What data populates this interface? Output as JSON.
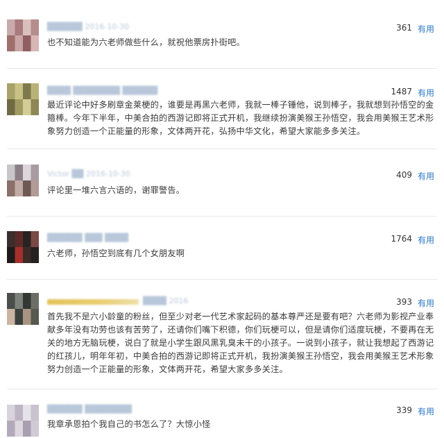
{
  "comments": [
    {
      "likes": "361",
      "useful_label": "有用",
      "text": "也不知道能为六老师做些什么，就祝他票房扑街吧。"
    },
    {
      "likes": "1487",
      "useful_label": "有用",
      "text": "最近评论中好多刷章金莱梗的，谁要是再黑六老师，我就一棒子锤他，说到棒子，我就想到孙悟空的金箍棒。今年下半年，中美合拍的西游记即将正式开机，我继续扮演美猴王孙悟空，我会用美猴王艺术形象努力创造一个正能量的形象，文体两开花，弘扬中华文化，希望大家能多多关注。"
    },
    {
      "likes": "409",
      "useful_label": "有用",
      "text": "评论里一堆六言六语的，谢罪警告。"
    },
    {
      "likes": "1764",
      "useful_label": "有用",
      "text": "六老师，孙悟空到底有几个女朋友啊"
    },
    {
      "likes": "393",
      "useful_label": "有用",
      "text": "首先我不是六小龄童的粉丝，但至少对老一代艺术家起码的基本尊严还是要有吧？六老师为影视产业奉献多年没有功劳也该有苦劳了，还请你们嘴下积德，你们玩梗可以，但是请你们适度玩梗，不要再在无关的地方无脑玩梗，说白了就是小学生跟风黑乳臭未干的小孩子。一说到小孩子，就让我想起了西游记的红孩儿，明年年初，中美合拍的西游记即将正式开机，我扮演美猴王孙悟空，我会用美猴王艺术形象努力创造一个正能量的形象，文体两开花，希望大家多多关注。"
    },
    {
      "likes": "339",
      "useful_label": "有用",
      "text": "我章承恩拍个我自己的书怎么了？大惊小怪"
    }
  ]
}
